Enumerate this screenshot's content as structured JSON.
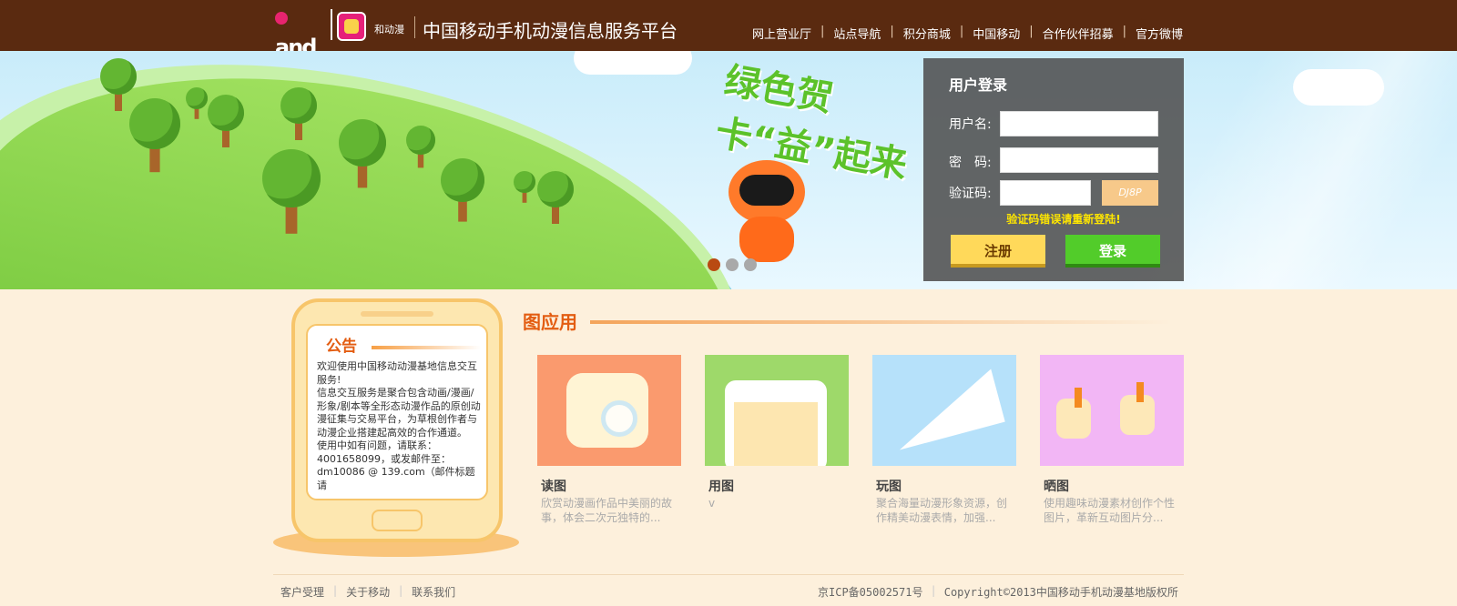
{
  "header": {
    "logo_text": "and和",
    "app_logo_label": "和动漫",
    "site_title": "中国移动手机动漫信息服务平台",
    "nav": [
      "网上营业厅",
      "站点导航",
      "积分商城",
      "中国移动",
      "合作伙伴招募",
      "官方微博"
    ]
  },
  "banner": {
    "promo_text": "绿色贺卡“益”起来",
    "slide_count": 3,
    "active_slide": 1
  },
  "login": {
    "title": "用户登录",
    "username_label": "用户名:",
    "username_value": "",
    "password_label": "密　码:",
    "password_value": "",
    "captcha_label": "验证码:",
    "captcha_value": "",
    "captcha_image_text": "DJ8P",
    "error_message": "验证码错误请重新登陆!",
    "register_button": "注册",
    "login_button": "登录"
  },
  "notice": {
    "title": "公告",
    "text": "欢迎使用中国移动动漫基地信息交互服务!\n信息交互服务是聚合包含动画/漫画/形象/剧本等全形态动漫作品的原创动漫征集与交易平台，为草根创作者与动漫企业搭建起高效的合作通道。\n使用中如有问题，请联系：\n4001658099，或发邮件至：\ndm10086 @ 139.com（邮件标题请"
  },
  "apps": {
    "title": "图应用",
    "items": [
      {
        "name": "读图",
        "desc": "欣赏动漫画作品中美丽的故事，体会二次元独特的...",
        "bg": "#fa9a6e"
      },
      {
        "name": "用图",
        "desc": "v",
        "bg": "#9ed96a"
      },
      {
        "name": "玩图",
        "desc": "聚合海量动漫形象资源，创作精美动漫表情，加强...",
        "bg": "#b6e1fa"
      },
      {
        "name": "晒图",
        "desc": "使用趣味动漫素材创作个性图片，革新互动图片分...",
        "bg": "#f2b6f5"
      }
    ]
  },
  "footer": {
    "links": [
      "客户受理",
      "关于移动",
      "联系我们"
    ],
    "icp": "京ICP备05002571号",
    "copyright": "Copyright©2013中国移动手机动漫基地版权所"
  },
  "colors": {
    "header_bg": "#5a2a10",
    "accent_orange": "#e35d12",
    "error_yellow": "#ffe600",
    "login_green": "#52cc2a",
    "register_yellow": "#ffd95a"
  }
}
